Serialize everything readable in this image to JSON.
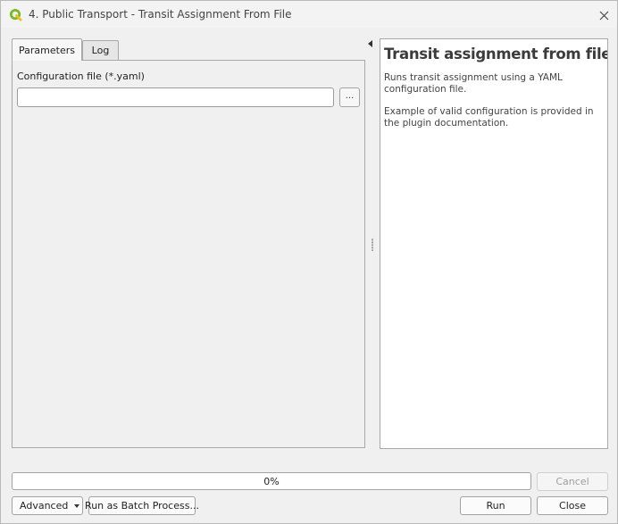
{
  "window": {
    "title": "4. Public Transport - Transit Assignment From File"
  },
  "tabs": [
    {
      "label": "Parameters",
      "active": true
    },
    {
      "label": "Log",
      "active": false
    }
  ],
  "parameters": {
    "config_label": "Configuration file (*.yaml)",
    "config_value": "",
    "browse_label": "..."
  },
  "help": {
    "title": "Transit assignment from file",
    "paragraphs": [
      "Runs transit assignment using a YAML configuration file.",
      "Example of valid configuration is provided in the plugin documentation."
    ]
  },
  "progress": {
    "value": 0,
    "label": "0%"
  },
  "buttons": {
    "cancel": "Cancel",
    "advanced": "Advanced",
    "batch": "Run as Batch Process...",
    "run": "Run",
    "close": "Close"
  },
  "colors": {
    "qgis_green": "#79b829",
    "progress_fill": "#4c9ee8",
    "help_title": "#3b3b3b"
  },
  "icons": {
    "app": "qgis-logo-icon",
    "close": "close-icon",
    "collapse": "collapse-arrow-icon",
    "advanced_dropdown": "chevron-down-icon"
  }
}
